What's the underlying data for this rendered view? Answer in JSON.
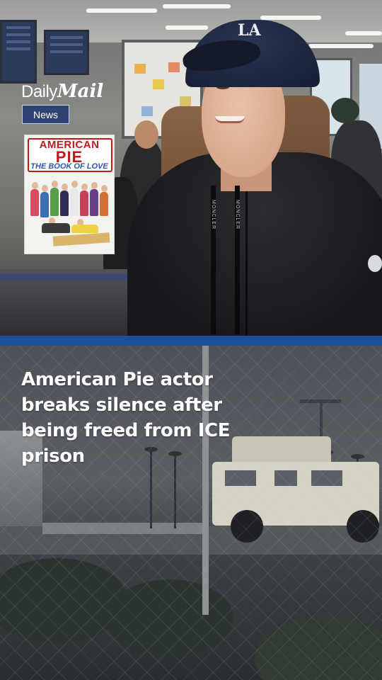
{
  "branding": {
    "logo_daily": "Daily",
    "logo_mail": "Mail",
    "section_badge": "News"
  },
  "cap_logo": "LA",
  "cover": {
    "line1": "AMERICAN",
    "line2": "PIE",
    "line3": "THE BOOK OF LOVE"
  },
  "lanyard_text": "MONCLER",
  "headline": "American Pie actor breaks silence after being freed from ICE prison",
  "colors": {
    "divider": "#1c4f9a",
    "badge_bg": "#14306e",
    "headline": "#ffffff",
    "cover_red": "#c01a1a"
  }
}
